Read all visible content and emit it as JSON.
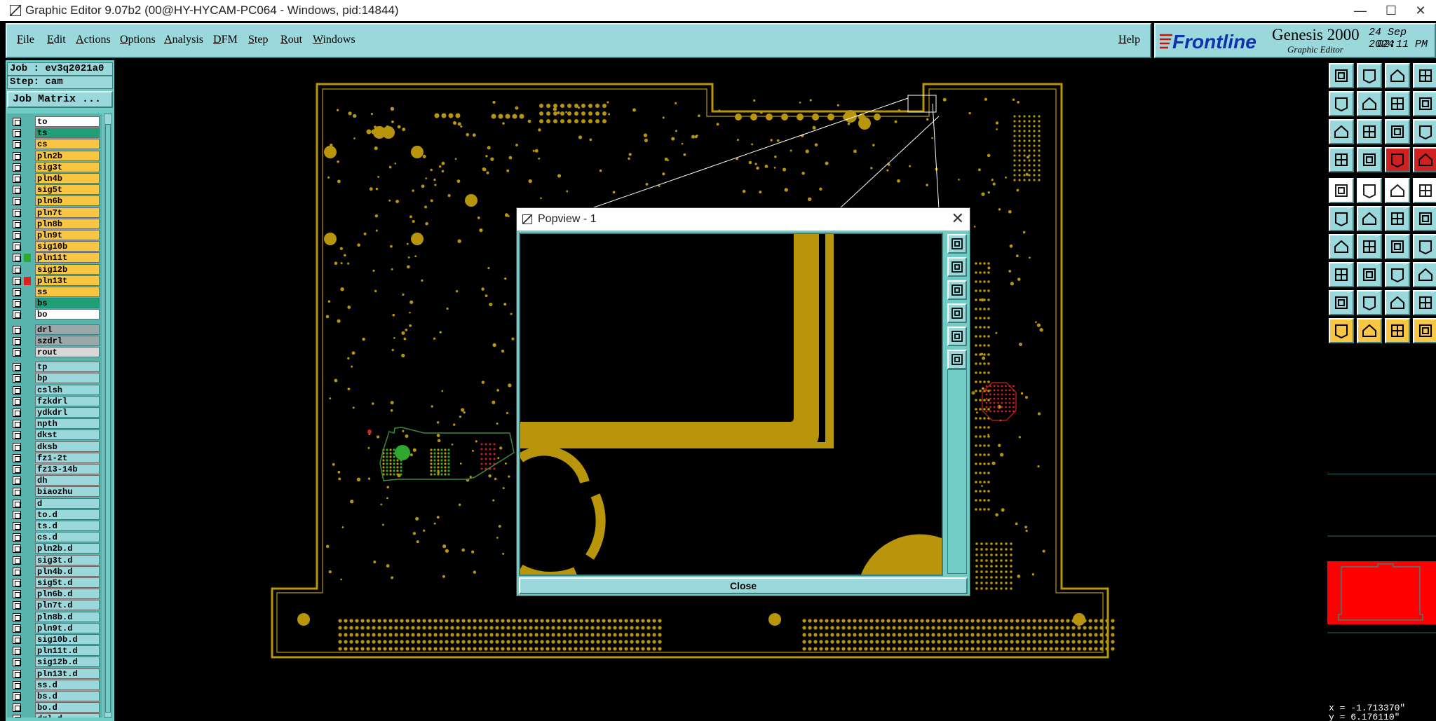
{
  "window": {
    "title": "Graphic Editor 9.07b2 (00@HY-HYCAM-PC064 - Windows, pid:14844)",
    "controls": [
      "—",
      "☐",
      "✕"
    ]
  },
  "menu": {
    "items": [
      "File",
      "Edit",
      "Actions",
      "Options",
      "Analysis",
      "DFM",
      "Step",
      "Rout",
      "Windows"
    ],
    "help": "Help"
  },
  "brand": {
    "logo_text": "Frontline",
    "product": "Genesis 2000",
    "subtitle": "Graphic Editor",
    "date": "24 Sep 2024",
    "time": "02:11 PM"
  },
  "job": {
    "job_label": "Job : ev3q2021a0",
    "step_label": "Step: cam",
    "job_matrix_button": "Job Matrix ..."
  },
  "layers": {
    "items": [
      {
        "name": "to",
        "color": "#ffffff",
        "mark": ""
      },
      {
        "name": "ts",
        "color": "#1f9e78",
        "mark": ""
      },
      {
        "name": "cs",
        "color": "#f8c642",
        "mark": ""
      },
      {
        "name": "pln2b",
        "color": "#f8c642",
        "mark": ""
      },
      {
        "name": "sig3t",
        "color": "#f8c642",
        "mark": ""
      },
      {
        "name": "pln4b",
        "color": "#f8c642",
        "mark": ""
      },
      {
        "name": "sig5t",
        "color": "#f8c642",
        "mark": ""
      },
      {
        "name": "pln6b",
        "color": "#f8c642",
        "mark": ""
      },
      {
        "name": "pln7t",
        "color": "#f8c642",
        "mark": ""
      },
      {
        "name": "pln8b",
        "color": "#f8c642",
        "mark": ""
      },
      {
        "name": "pln9t",
        "color": "#f8c642",
        "mark": ""
      },
      {
        "name": "sig10b",
        "color": "#f8c642",
        "mark": ""
      },
      {
        "name": "pln11t",
        "color": "#f8c642",
        "mark": "#2fa82f"
      },
      {
        "name": "sig12b",
        "color": "#f8c642",
        "mark": ""
      },
      {
        "name": "pln13t",
        "color": "#f8c642",
        "mark": "#e02020"
      },
      {
        "name": "ss",
        "color": "#f8c642",
        "mark": ""
      },
      {
        "name": "bs",
        "color": "#1f9e78",
        "mark": ""
      },
      {
        "name": "bo",
        "color": "#ffffff",
        "mark": ""
      },
      {
        "name": "drl",
        "color": "#9aa8ac",
        "mark": ""
      },
      {
        "name": "szdrl",
        "color": "#9aa8ac",
        "mark": ""
      },
      {
        "name": "rout",
        "color": "#d8d8d8",
        "mark": ""
      },
      {
        "name": "tp",
        "color": "#9ad8dc",
        "mark": ""
      },
      {
        "name": "bp",
        "color": "#9ad8dc",
        "mark": ""
      },
      {
        "name": "cslsh",
        "color": "#9ad8dc",
        "mark": ""
      },
      {
        "name": "fzkdrl",
        "color": "#9ad8dc",
        "mark": ""
      },
      {
        "name": "ydkdrl",
        "color": "#9ad8dc",
        "mark": ""
      },
      {
        "name": "npth",
        "color": "#9ad8dc",
        "mark": ""
      },
      {
        "name": "dkst",
        "color": "#9ad8dc",
        "mark": ""
      },
      {
        "name": "dksb",
        "color": "#9ad8dc",
        "mark": ""
      },
      {
        "name": "fz1-2t",
        "color": "#9ad8dc",
        "mark": ""
      },
      {
        "name": "fz13-14b",
        "color": "#9ad8dc",
        "mark": ""
      },
      {
        "name": "dh",
        "color": "#9ad8dc",
        "mark": ""
      },
      {
        "name": "biaozhu",
        "color": "#9ad8dc",
        "mark": ""
      },
      {
        "name": "d",
        "color": "#9ad8dc",
        "mark": ""
      },
      {
        "name": "to.d",
        "color": "#9ad8dc",
        "mark": ""
      },
      {
        "name": "ts.d",
        "color": "#9ad8dc",
        "mark": ""
      },
      {
        "name": "cs.d",
        "color": "#9ad8dc",
        "mark": ""
      },
      {
        "name": "pln2b.d",
        "color": "#9ad8dc",
        "mark": ""
      },
      {
        "name": "sig3t.d",
        "color": "#9ad8dc",
        "mark": ""
      },
      {
        "name": "pln4b.d",
        "color": "#9ad8dc",
        "mark": ""
      },
      {
        "name": "sig5t.d",
        "color": "#9ad8dc",
        "mark": ""
      },
      {
        "name": "pln6b.d",
        "color": "#9ad8dc",
        "mark": ""
      },
      {
        "name": "pln7t.d",
        "color": "#9ad8dc",
        "mark": ""
      },
      {
        "name": "pln8b.d",
        "color": "#9ad8dc",
        "mark": ""
      },
      {
        "name": "pln9t.d",
        "color": "#9ad8dc",
        "mark": ""
      },
      {
        "name": "sig10b.d",
        "color": "#9ad8dc",
        "mark": ""
      },
      {
        "name": "pln11t.d",
        "color": "#9ad8dc",
        "mark": ""
      },
      {
        "name": "sig12b.d",
        "color": "#9ad8dc",
        "mark": ""
      },
      {
        "name": "pln13t.d",
        "color": "#9ad8dc",
        "mark": ""
      },
      {
        "name": "ss.d",
        "color": "#9ad8dc",
        "mark": ""
      },
      {
        "name": "bs.d",
        "color": "#9ad8dc",
        "mark": ""
      },
      {
        "name": "bo.d",
        "color": "#9ad8dc",
        "mark": ""
      },
      {
        "name": "drl.d",
        "color": "#9ad8dc",
        "mark": ""
      }
    ]
  },
  "popview": {
    "title": "Popview - 1",
    "close_button": "Close"
  },
  "status": {
    "x": "x = -1.713370\"",
    "y": "y =  6.176110\""
  },
  "colors": {
    "copper": "#b8950a",
    "panel": "#9ad8dc",
    "highlight": "#d02020",
    "selected_green": "#2fa82f",
    "minimap_red": "#ff0000"
  }
}
